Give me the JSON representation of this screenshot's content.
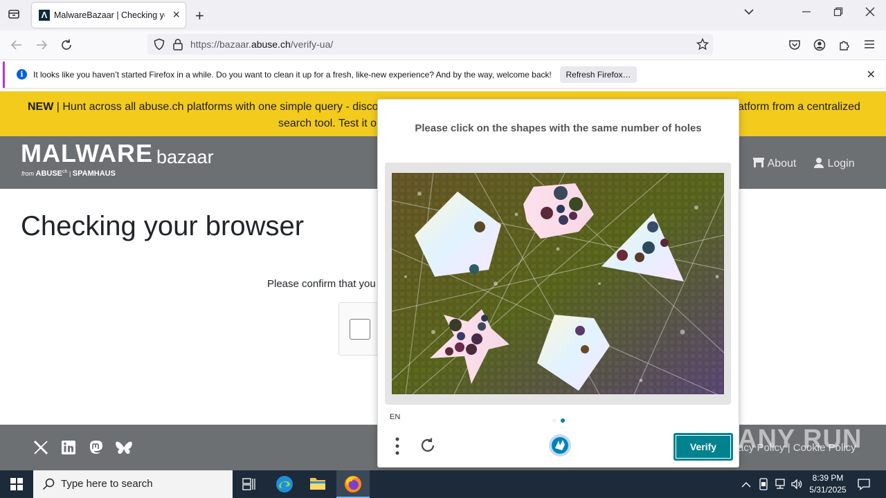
{
  "browser": {
    "tab_title": "MalwareBazaar | Checking your browser",
    "tab_favicon": "Λ",
    "url_prefix": "https://bazaar.",
    "url_domain": "abuse.ch",
    "url_path": "/verify-ua/"
  },
  "notification": {
    "message": "It looks like you haven’t started Firefox in a while. Do you want to clean it up for a fresh, like-new experience? And by the way, welcome back!",
    "button": "Refresh Firefox…"
  },
  "banner": {
    "new_label": "NEW",
    "line1": " | Hunt across all abuse.ch platforms with one simple query - discov",
    "line1_right": "atform from a centralized",
    "line2": "search tool. Test it ou"
  },
  "site": {
    "logo_main": "MALWARE",
    "logo_sub": "bazaar",
    "logo_from": "from",
    "logo_abuse": "ABUSE",
    "logo_abuse_suffix": "ch",
    "logo_spamhaus": "SPAMHAUS",
    "nav": [
      {
        "label": "About",
        "icon": "home-icon"
      },
      {
        "label": "Login",
        "icon": "user-icon"
      }
    ],
    "page_title": "Checking your browser",
    "confirm_text": "Please confirm that you",
    "footer_right": "acy Policy  |  Cookie Policy"
  },
  "captcha": {
    "prompt": "Please click on the shapes with the same number of holes",
    "language": "EN",
    "verify_label": "Verify",
    "colors": {
      "accent": "#00838f"
    }
  },
  "watermark": "ANY RUN",
  "taskbar": {
    "search_placeholder": "Type here to search",
    "time": "8:39 PM",
    "date": "5/31/2025"
  }
}
